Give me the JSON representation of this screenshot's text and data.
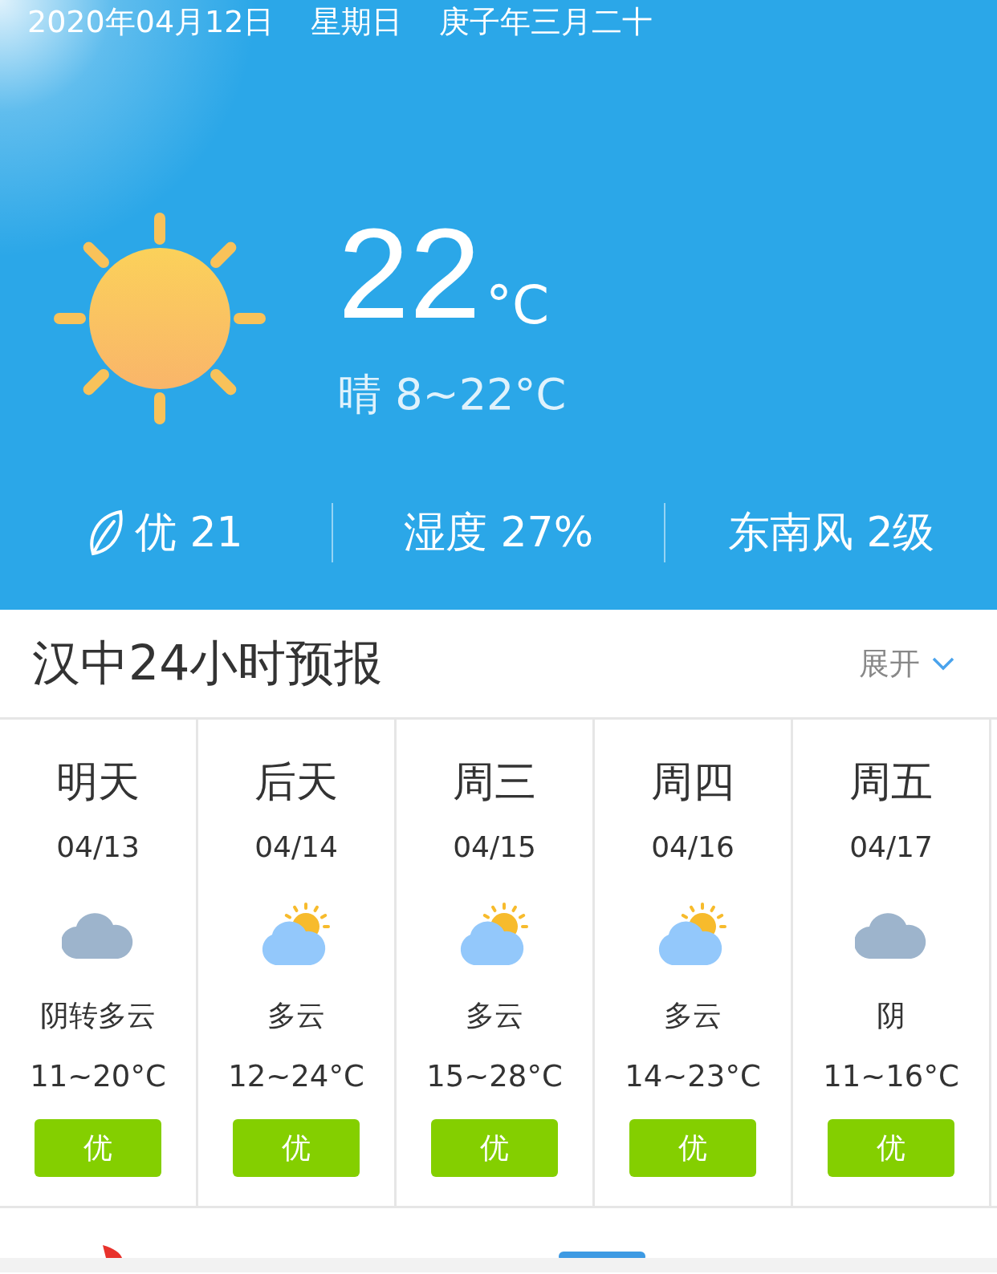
{
  "date_bar": {
    "date": "2020年04月12日",
    "weekday": "星期日",
    "lunar": "庚子年三月二十"
  },
  "current": {
    "temperature": "22",
    "unit": "°C",
    "summary": "晴 8~22°C"
  },
  "metrics": [
    {
      "kind": "aqi",
      "text": "优 21"
    },
    {
      "kind": "plain",
      "text": "湿度 27%"
    },
    {
      "kind": "plain",
      "text": "东南风 2级"
    }
  ],
  "forecast_header": {
    "title": "汉中24小时预报",
    "expand": "展开"
  },
  "days": [
    {
      "day": "明天",
      "date": "04/13",
      "kind": "cloudy",
      "condition": "阴转多云",
      "temp": "11~20°C",
      "aqi": "优"
    },
    {
      "day": "后天",
      "date": "04/14",
      "kind": "partly_cloudy",
      "condition": "多云",
      "temp": "12~24°C",
      "aqi": "优"
    },
    {
      "day": "周三",
      "date": "04/15",
      "kind": "partly_cloudy",
      "condition": "多云",
      "temp": "15~28°C",
      "aqi": "优"
    },
    {
      "day": "周四",
      "date": "04/16",
      "kind": "partly_cloudy",
      "condition": "多云",
      "temp": "14~23°C",
      "aqi": "优"
    },
    {
      "day": "周五",
      "date": "04/17",
      "kind": "cloudy",
      "condition": "阴",
      "temp": "11~16°C",
      "aqi": "优"
    }
  ]
}
